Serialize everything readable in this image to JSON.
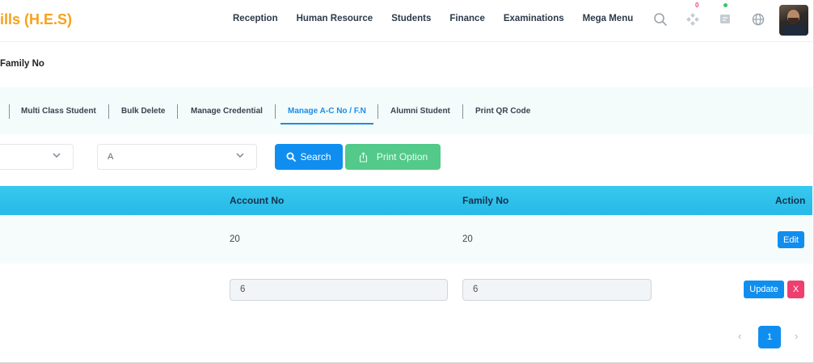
{
  "brand": {
    "title": "ills (H.E.S)",
    "color": "#f5a21b"
  },
  "nav": {
    "items": [
      "Reception",
      "Human Resource",
      "Students",
      "Finance",
      "Examinations",
      "Mega Menu"
    ],
    "icons": [
      "search-icon",
      "apps-icon",
      "chat-icon",
      "globe-icon"
    ],
    "notification_count": "0"
  },
  "page": {
    "title": "Family No"
  },
  "tabs": {
    "items": [
      "Multi Class Student",
      "Bulk Delete",
      "Manage Credential",
      "Manage A-C No / F.N",
      "Alumni Student",
      "Print QR Code"
    ],
    "active": "Manage A-C No / F.N"
  },
  "filters": {
    "class_value": "",
    "section_value": "A",
    "search_label": "Search",
    "print_label": "Print Option"
  },
  "table": {
    "headers": {
      "account": "Account No",
      "family": "Family No",
      "action": "Action"
    },
    "row1": {
      "account": "20",
      "family": "20",
      "edit_label": "Edit"
    },
    "row2": {
      "account": "6",
      "family": "6",
      "update_label": "Update",
      "cancel_label": "X"
    }
  },
  "pagination": {
    "current": "1",
    "prev": "‹",
    "next": "›"
  },
  "colors": {
    "primary": "#0f8ef0",
    "success": "#53c98a",
    "danger": "#ee3f6e",
    "header": "#2fc0eb"
  }
}
